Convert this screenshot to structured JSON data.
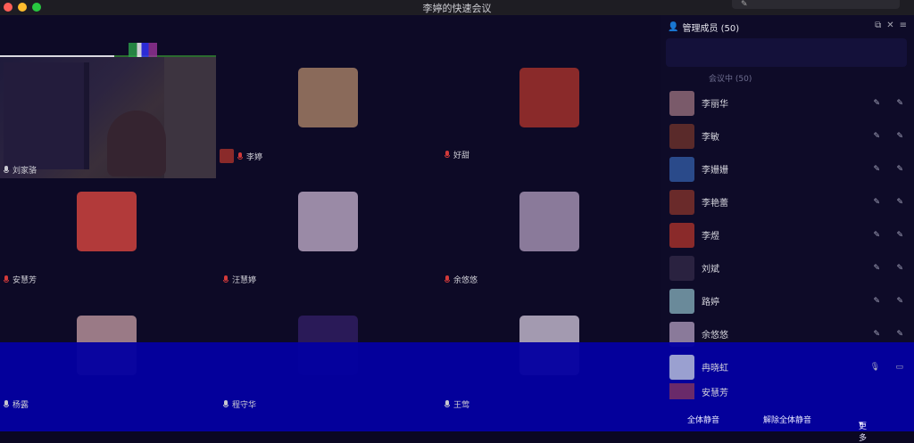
{
  "window": {
    "title": "李婷的快速会议"
  },
  "top_button": {
    "label": ""
  },
  "grid": {
    "tiles": [
      {
        "name": "刘家骆",
        "avatar_color": "#2a2234",
        "mic": "on"
      },
      {
        "name": "李婷",
        "avatar_color": "#8a6a5a",
        "mic": "muted"
      },
      {
        "name": "好甜",
        "avatar_color": "#8a2a2a",
        "mic": "muted"
      },
      {
        "name": "安慧芳",
        "avatar_color": "#b23a3a",
        "mic": "muted"
      },
      {
        "name": "汪慧婷",
        "avatar_color": "#9a8aa6",
        "mic": "muted"
      },
      {
        "name": "余悠悠",
        "avatar_color": "#8a7a9a",
        "mic": "muted"
      },
      {
        "name": "杨露",
        "avatar_color": "#9a7a86",
        "mic": "on"
      },
      {
        "name": "程守华",
        "avatar_color": "#2a1a58",
        "mic": "on"
      },
      {
        "name": "王莺",
        "avatar_color": "#a39ab0",
        "mic": "on"
      }
    ]
  },
  "panel": {
    "title": "管理成员 (50)",
    "search_placeholder": "",
    "section": "会议中 (50)",
    "members": [
      {
        "name": "李丽华",
        "color": "#7a5a6a"
      },
      {
        "name": "李敏",
        "color": "#5a2a2a"
      },
      {
        "name": "李姗姗",
        "color": "#2a4a8a"
      },
      {
        "name": "李艳蕾",
        "color": "#6a2a2a"
      },
      {
        "name": "李煜",
        "color": "#8a2a2a"
      },
      {
        "name": "刘斌",
        "color": "#2a2240"
      },
      {
        "name": "路婷",
        "color": "#6a8a9a"
      },
      {
        "name": "余悠悠",
        "color": "#8a7a9a"
      },
      {
        "name": "冉晓虹",
        "color": "#9aa0d0"
      },
      {
        "name": "安慧芳",
        "color": "#6a2a6a"
      }
    ],
    "footer": {
      "mute_all": "全体静音",
      "unmute_all": "解除全体静音",
      "more": "更多"
    }
  }
}
